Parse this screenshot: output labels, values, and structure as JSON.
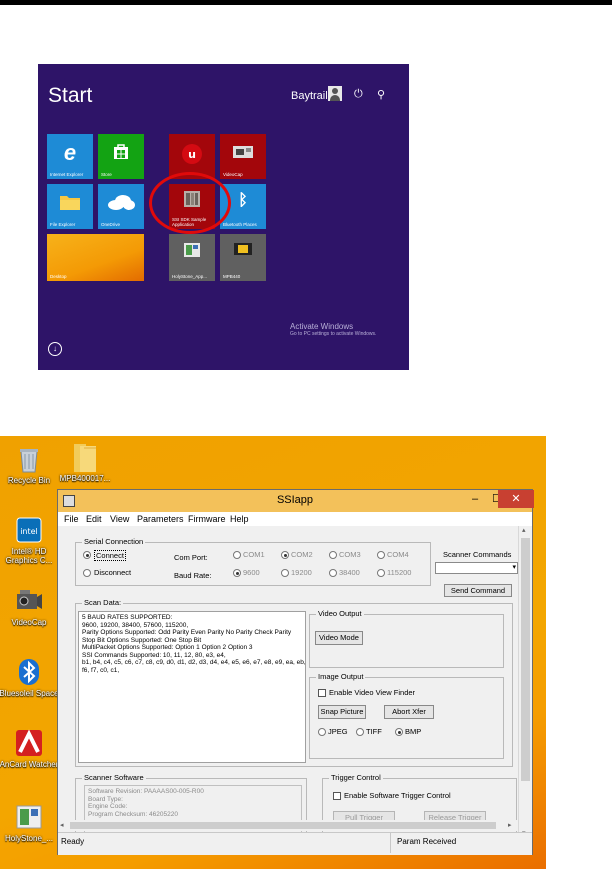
{
  "start_screen": {
    "title": "Start",
    "user_name": "Baytrail",
    "tiles": [
      {
        "label": "Internet Explorer",
        "color": "#1e8bd6",
        "icon": "internet-explorer-icon"
      },
      {
        "label": "Store",
        "color": "#13a313",
        "icon": "store-icon"
      },
      {
        "label": "",
        "color": "#a3060b",
        "icon": "app-icon"
      },
      {
        "label": "VideoCap",
        "color": "#a3060b",
        "icon": "videocap-icon"
      },
      {
        "label": "File Explorer",
        "color": "#1e8bd6",
        "icon": "folder-icon"
      },
      {
        "label": "OneDrive",
        "color": "#1e8bd6",
        "icon": "cloud-icon"
      },
      {
        "label": "SSI SDK Sample Application",
        "color": "#a3060b",
        "icon": "ssi-app-icon"
      },
      {
        "label": "Bluetooth Places",
        "color": "#1e8bd6",
        "icon": "bluetooth-icon"
      },
      {
        "label": "Desktop",
        "color": "#f5a30a",
        "icon": "desktop-icon"
      },
      {
        "label": "HolyStone_App...",
        "color": "#606060",
        "icon": "holystone-icon"
      },
      {
        "label": "MPB440",
        "color": "#606060",
        "icon": "mpb-icon"
      }
    ],
    "watermark_title": "Activate Windows",
    "watermark_text": "Go to PC settings to activate Windows."
  },
  "desktop": {
    "icons": [
      {
        "label": "Recycle Bin"
      },
      {
        "label": "MPB400017..."
      },
      {
        "label": "Intel® HD Graphics C..."
      },
      {
        "label": "VideoCap"
      },
      {
        "label": "Bluesoleil Space"
      },
      {
        "label": "AnCard Watcher"
      },
      {
        "label": "HolyStone_..."
      }
    ]
  },
  "window": {
    "title": "SSIapp",
    "menu": [
      "File",
      "Edit",
      "View",
      "Parameters",
      "Firmware",
      "Help"
    ],
    "serial": {
      "group_label": "Serial Connection",
      "connect": "Connect",
      "disconnect": "Disconnect",
      "com_port_label": "Com Port:",
      "baud_rate_label": "Baud Rate:",
      "com_ports": [
        "COM1",
        "COM2",
        "COM3",
        "COM4"
      ],
      "baud_rates": [
        "9600",
        "19200",
        "38400",
        "115200"
      ]
    },
    "scanner_commands": {
      "label": "Scanner Commands",
      "send_button": "Send Command"
    },
    "scan_data": {
      "group_label": "Scan Data:",
      "text": "5 BAUD RATES SUPPORTED:\n9600, 19200, 38400, 57600, 115200,\nParity Options Supported: Odd Parity Even Parity No Parity Check Parity\nStop Bit Options Supported: One Stop Bit\nMultiPacket Options Supported: Option 1 Option 2 Option 3\nSSI Commands Supported: 10, 11, 12, 80, e3, e4,\nb1, b4, c4, c5, c6, c7, c8, c9, d0, d1, d2, d3, d4, e4, e5, e6, e7, e8, e9, ea, eb, f3,\nf6, f7, c0, c1,"
    },
    "video_output": {
      "group_label": "Video Output",
      "button": "Video Mode"
    },
    "image_output": {
      "group_label": "Image Output",
      "viewfinder": "Enable Video View Finder",
      "snap_button": "Snap Picture",
      "abort_button": "Abort Xfer",
      "formats": [
        "JPEG",
        "TIFF",
        "BMP"
      ]
    },
    "scanner_software": {
      "group_label": "Scanner Software",
      "text": "Software Revision: PAAAAS00-005-R00\nBoard Type:\nEngine Code:\nProgram Checksum: 46205220"
    },
    "trigger": {
      "group_label": "Trigger Control",
      "enable": "Enable Software Trigger Control",
      "pull": "Pull Trigger",
      "release": "Release Trigger"
    },
    "status": {
      "left": "Ready",
      "right": "Param Received"
    }
  }
}
